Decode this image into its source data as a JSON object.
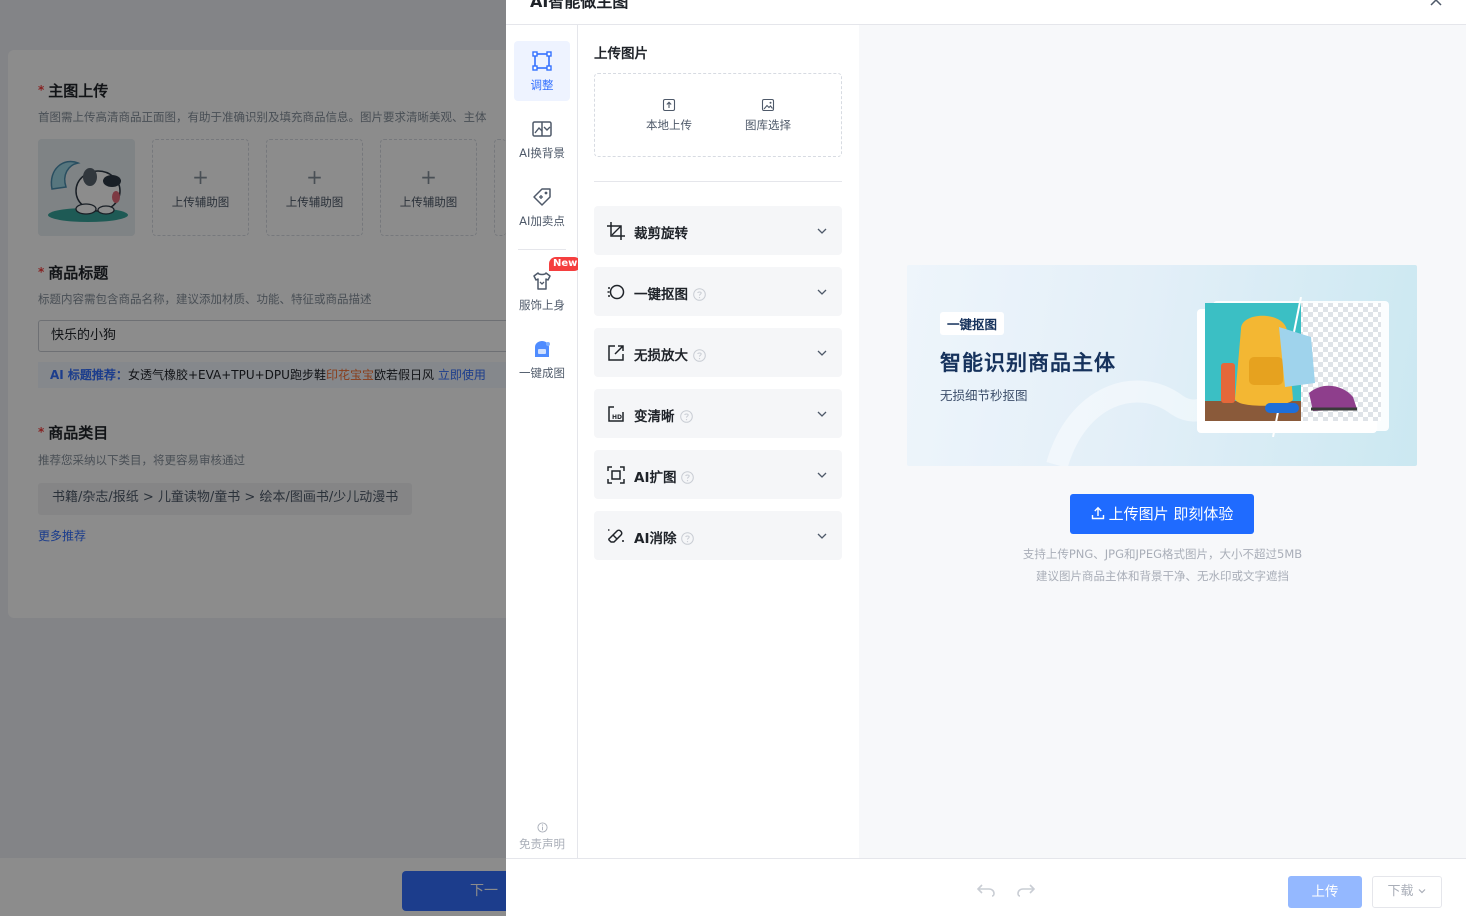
{
  "background_page": {
    "main_image": {
      "title": "主图上传",
      "desc": "首图需上传高清商品正面图，有助于准确识别及填充商品信息。图片要求清晰美观、主体",
      "add_slots": [
        "上传辅助图",
        "上传辅助图",
        "上传辅助图"
      ]
    },
    "product_title": {
      "title": "商品标题",
      "desc": "标题内容需包含商品名称，建议添加材质、功能、特征或商品描述",
      "value": "快乐的小狗",
      "ai_rec_prefix": "AI 标题推荐：",
      "ai_rec_text": "女透气橡胶+EVA+TPU+DPU跑步鞋",
      "ai_rec_highlight": "印花宝宝",
      "ai_rec_suffix": "欧若假日风",
      "ai_rec_link": "立即使用"
    },
    "category": {
      "title": "商品类目",
      "desc": "推荐您采纳以下类目，将更容易审核通过",
      "path": "书籍/杂志/报纸 > 儿童读物/童书 > 绘本/图画书/少儿动漫书",
      "more": "更多推荐"
    },
    "next_button": "下一"
  },
  "drawer": {
    "title": "AI智能做主图",
    "rail": [
      {
        "label": "调整",
        "icon": "adjust-icon",
        "active": true
      },
      {
        "label": "AI换背景",
        "icon": "replace-background-icon",
        "active": false
      },
      {
        "label": "AI加卖点",
        "icon": "selling-point-tag-icon",
        "active": false
      },
      {
        "label": "服饰上身",
        "icon": "tshirt-icon",
        "active": false,
        "badge": "New"
      },
      {
        "label": "一键成图",
        "icon": "one-click-image-icon",
        "active": false
      }
    ],
    "disclaimer": "免责声明",
    "upload": {
      "title": "上传图片",
      "local": "本地上传",
      "gallery": "图库选择"
    },
    "tools": [
      {
        "label": "裁剪旋转",
        "icon": "crop-rotate-icon",
        "help": false
      },
      {
        "label": "一键抠图",
        "icon": "cutout-icon",
        "help": true
      },
      {
        "label": "无损放大",
        "icon": "upscale-icon",
        "help": true
      },
      {
        "label": "变清晰",
        "icon": "hd-icon",
        "help": true
      },
      {
        "label": "AI扩图",
        "icon": "expand-image-icon",
        "help": true
      },
      {
        "label": "AI消除",
        "icon": "eraser-icon",
        "help": true
      }
    ],
    "banner": {
      "tag": "一键抠图",
      "title": "智能识别商品主体",
      "subtitle": "无损细节秒抠图"
    },
    "cta": "上传图片 即刻体验",
    "hint_1": "支持上传PNG、JPG和JPEG格式图片，大小不超过5MB",
    "hint_2": "建议图片商品主体和背景干净、无水印或文字遮挡",
    "footer": {
      "upload": "上传",
      "download": "下载"
    }
  },
  "colors": {
    "accent": "#1f6bff",
    "accent_light": "#3370ff",
    "disabled_primary": "#94b8ff",
    "badge_red": "#f53f3f"
  }
}
